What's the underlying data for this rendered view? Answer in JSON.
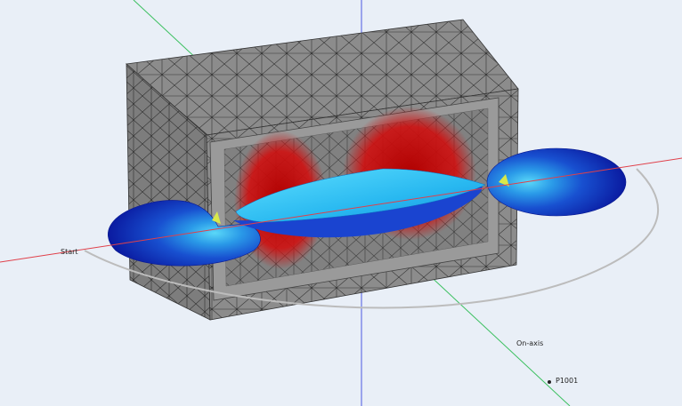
{
  "scene": {
    "labels": {
      "start": "Start",
      "on_axis": "On-axis",
      "probe": "P1001"
    },
    "colors": {
      "background": "#e9eff7",
      "mesh_fill": "#8a8a8a",
      "mesh_line": "#3a3a3a",
      "axis_x": "#e0404a",
      "axis_y": "#3cc060",
      "axis_z": "#4a5ae0",
      "field_red": "#c81010",
      "field_blue": "#1030c0",
      "field_cyan": "#30c8f0",
      "arc": "#bcbcbc"
    }
  }
}
